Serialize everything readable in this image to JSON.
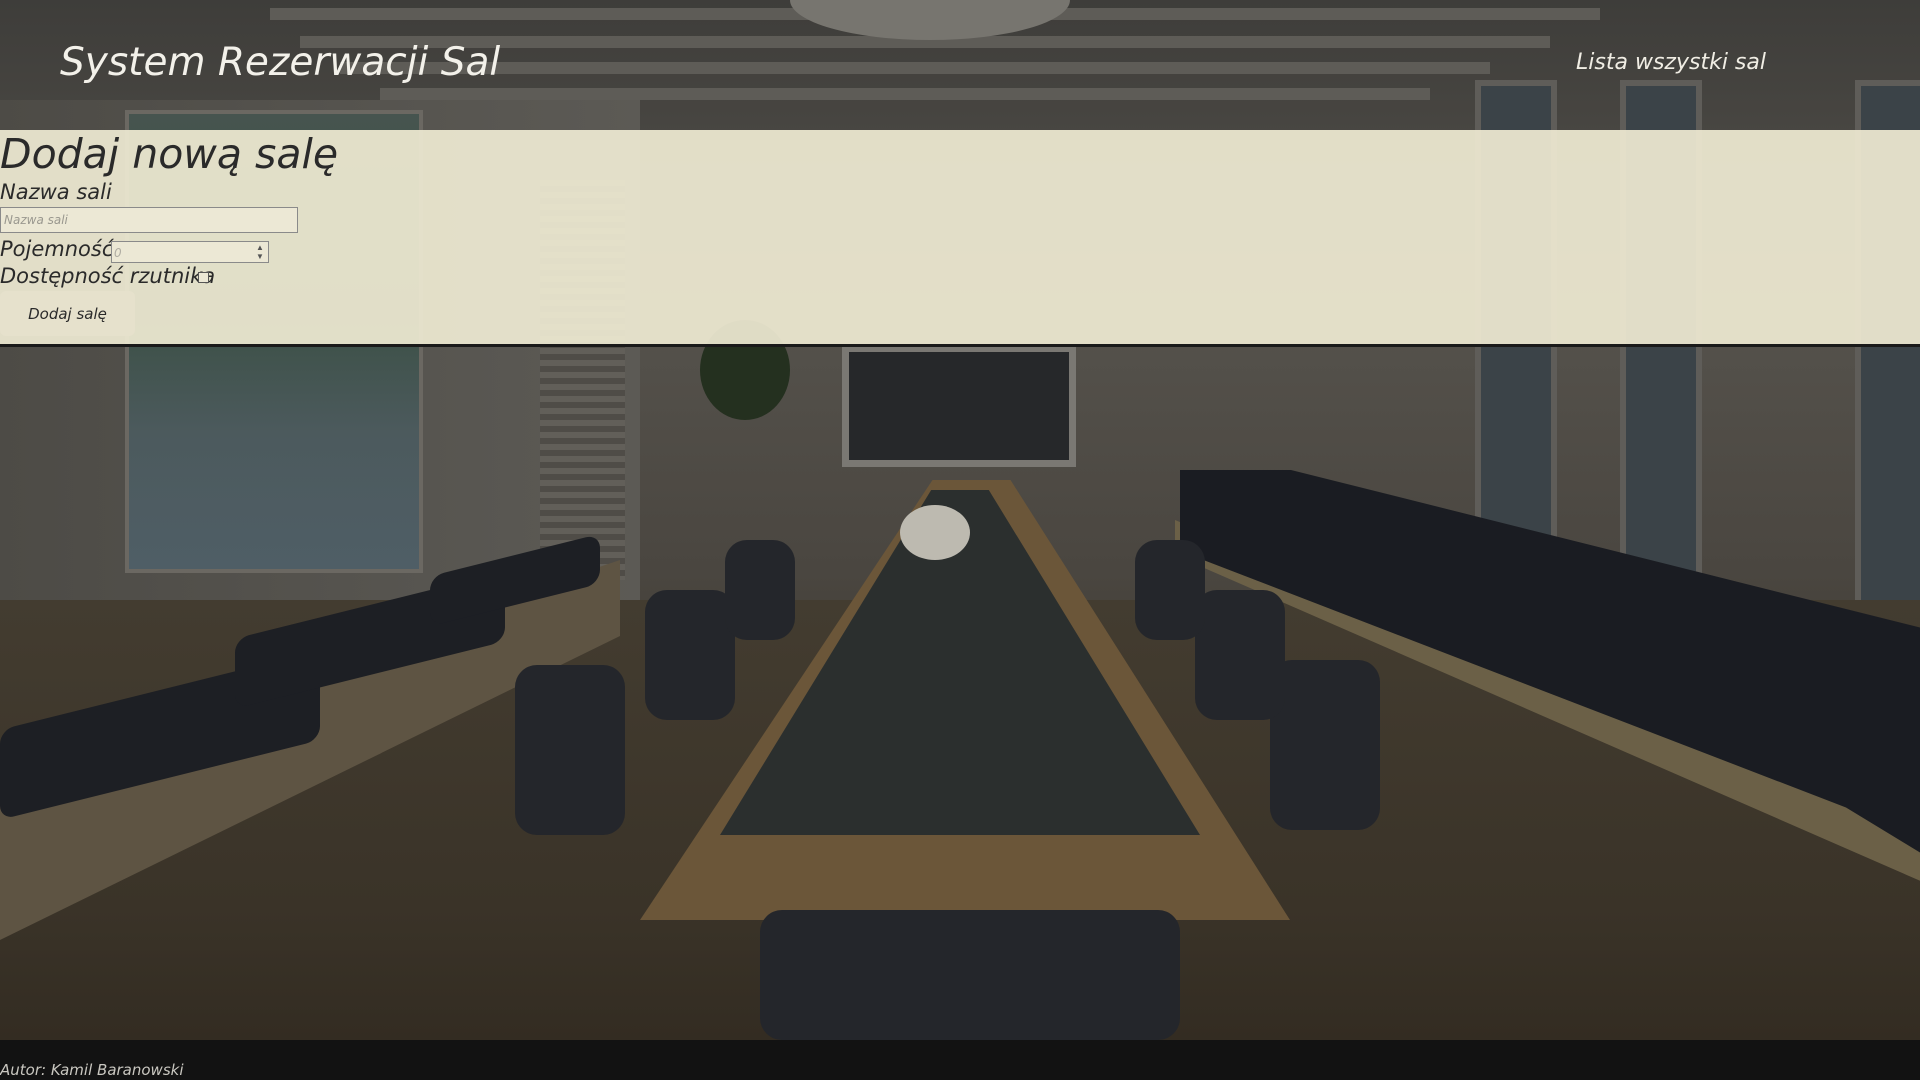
{
  "header": {
    "title": "System Rezerwacji Sal",
    "nav_link": "Lista wszystki sal"
  },
  "form": {
    "heading": "Dodaj nową salę",
    "name_label": "Nazwa sali",
    "name_placeholder": "Nazwa sali",
    "capacity_label": "Pojemność",
    "capacity_placeholder": "0",
    "projector_label": "Dostępność rzutnika",
    "projector_checked": false,
    "submit_label": "Dodaj salę"
  },
  "footer": {
    "author": "Autor: Kamil Baranowski"
  }
}
